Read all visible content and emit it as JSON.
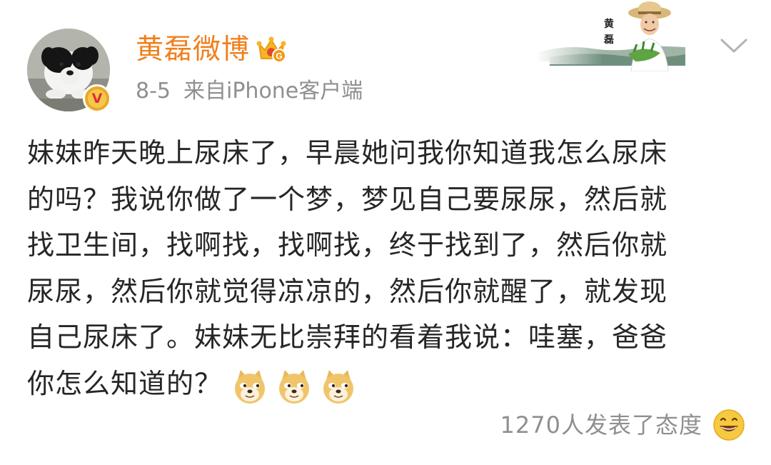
{
  "post": {
    "author": {
      "name": "黄磊微博",
      "avatar_icon": "dog-avatar",
      "verified_badge_text": "V",
      "vip_icon": "vip-crown-icon"
    },
    "date": "8-5",
    "source": "来自iPhone客户端",
    "card_skin": {
      "vertical_text": "黄 磊",
      "icon": "card-skin-illustration"
    },
    "text_lines": [
      "妹妹昨天晚上尿床了，早晨她问我你知道我怎么尿床",
      "的吗？我说你做了一个梦，梦见自己要尿尿，然后就",
      "找卫生间，找啊找，找啊找，终于找到了，然后你就",
      "尿尿，然后你就觉得凉凉的，然后你就醒了，就发现",
      "自己尿床了。妹妹无比崇拜的看着我说：哇塞，爸爸",
      "你怎么知道的？"
    ],
    "emoji_icons": [
      "doge-emoji",
      "doge-emoji",
      "doge-emoji"
    ],
    "reactions": {
      "text": "1270人发表了态度",
      "icon": "smile-emoji"
    },
    "colors": {
      "author_name": "#f0801c",
      "meta": "#8f8f8f",
      "body_text": "#262626"
    }
  }
}
